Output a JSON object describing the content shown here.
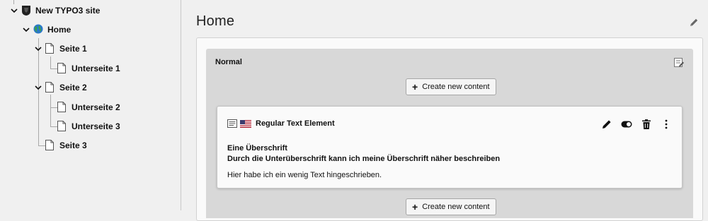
{
  "tree": {
    "root": {
      "label": "New TYPO3 site",
      "icon": "typo3-logo-icon"
    },
    "home": {
      "label": "Home",
      "icon": "globe-icon"
    },
    "pages": [
      {
        "label": "Seite 1"
      },
      {
        "label": "Unterseite 1"
      },
      {
        "label": "Seite 2"
      },
      {
        "label": "Unterseite 2"
      },
      {
        "label": "Unterseite 3"
      },
      {
        "label": "Seite 3"
      }
    ]
  },
  "main": {
    "title": "Home",
    "column": {
      "title": "Normal",
      "create_label": "Create new content",
      "element": {
        "type_icon": "text-element-icon",
        "flag": "us-flag-icon",
        "title": "Regular Text Element",
        "header": "Eine Überschrift",
        "subheader": "Durch die Unterüberschrift kann ich meine Überschrift näher beschreiben",
        "bodytext": "Hier habe ich ein wenig Text hingeschrieben."
      }
    }
  },
  "colors": {
    "background": "#f0f0f0",
    "column": "#d8d8d8",
    "card": "#fafafa",
    "typo3_orange": "#ff8700"
  }
}
